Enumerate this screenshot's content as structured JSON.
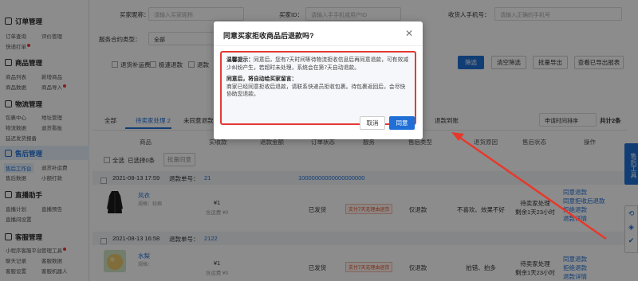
{
  "sidebar": {
    "orders": {
      "title": "订单管理",
      "items": [
        "订单查询",
        "评价管理",
        "快递打单"
      ]
    },
    "goods": {
      "title": "商品管理",
      "items": [
        "商品列表",
        "新增商品",
        "商品数据",
        "商品导入"
      ]
    },
    "logistics": {
      "title": "物流管理",
      "items": [
        "包裹中心",
        "地址管理",
        "物流数据",
        "退货看板",
        "延迟发货报备"
      ]
    },
    "aftersale": {
      "title": "售后管理",
      "items": [
        "售后工作台",
        "退货补运费",
        "售后数据",
        "小额打款"
      ]
    },
    "live": {
      "title": "直播助手",
      "items": [
        "直播计划",
        "直播预告",
        "直播间设置"
      ]
    },
    "service": {
      "title": "客服管理",
      "items": [
        "小程序客服平台",
        "管理工具",
        "聊天记录",
        "客服数据",
        "客服设置",
        "客服机器人"
      ]
    }
  },
  "filters": {
    "buyer_nick_label": "买家昵称：",
    "buyer_nick_placeholder": "请输入买家昵称",
    "buyer_id_label": "买家ID：",
    "buyer_id_placeholder": "请输入手手机或用户ID",
    "receiver_phone_label": "收货人手机号：",
    "receiver_phone_placeholder": "请输入正确的手机号",
    "contract_label": "服务合约类型：",
    "contract_value": "全部",
    "checkbox_shipping_refund": "退货补运费",
    "checkbox_fast_refund": "极速退款",
    "checkbox_3": "退款",
    "checkbox_4": "退款",
    "checkbox_5": "退款"
  },
  "actions": {
    "filter": "筛选",
    "clear": "清空筛选",
    "export": "批量导出",
    "view_report": "查看已导出报表"
  },
  "tabs": {
    "all": "全部",
    "pending": "待卖家处理 2",
    "unsynced": "未同意退款",
    "done": "退款到账"
  },
  "sort": {
    "label": "申请时间排序",
    "total": "共计2条"
  },
  "table": {
    "select_all": "全选",
    "selected": "已选择0条",
    "batch_agree": "批量同意",
    "headers": {
      "goods": "商品",
      "paid": "实收款",
      "refund_amount": "退款金额",
      "order_status": "订单状态",
      "service": "服务",
      "aftersale_type": "售后类型",
      "reason": "退货原因",
      "aftersale_status": "售后状态",
      "action": "操作"
    }
  },
  "orders": [
    {
      "date": "2021-08-13 17:59",
      "refund_no_label": "退款单号：",
      "refund_no": "21",
      "refund_tail": "10000000000000000000",
      "goods_name": "风衣",
      "goods_spec": "规格：轻棉",
      "paid": "¥1",
      "paid_note": "含运费 ¥0",
      "status": "已发货",
      "tag": "支付7天无理由退货",
      "type": "仅退款",
      "reason": "不喜欢、效果不好",
      "after_status": "待卖家处理",
      "remain": "剩余1天23小时",
      "actions": [
        "同意退款",
        "同意拒收后退款",
        "拒绝退款",
        "退款详情"
      ]
    },
    {
      "date": "2021-08-13 16:58",
      "refund_no_label": "退款单号：",
      "refund_no": "2122",
      "refund_tail": "",
      "goods_name": "水梨",
      "goods_spec": "规格：",
      "paid": "¥1",
      "paid_note": "含运费 ¥0",
      "status": "已发货",
      "tag": "支付7天无理由退货",
      "type": "仅退款",
      "reason": "拍错、拍多",
      "after_status": "待卖家处理",
      "remain": "剩余1天23小时",
      "actions": [
        "同意退款",
        "拒绝退款",
        "退款详情"
      ]
    }
  ],
  "float_tool": "售后工具",
  "modal": {
    "title": "同意买家拒收商品后退款吗?",
    "tip_label": "温馨提示：",
    "tip_text": "同意后，您有7天时间等待物流拒收信息后再同意退款，可有效减少纠纷产生，若超时未处理，系统会在第7天自动退款。",
    "message_label": "同意后，将自动给买家留言：",
    "message_text": "商家已经同意拒收后退款，请联系快递员拒收包裹。待包裹返回后，会尽快协助您退款。",
    "cancel": "取消",
    "confirm": "同意"
  },
  "colors": {
    "primary": "#1f6fd6",
    "highlight": "#e53935",
    "arrow": "#e8382a"
  }
}
